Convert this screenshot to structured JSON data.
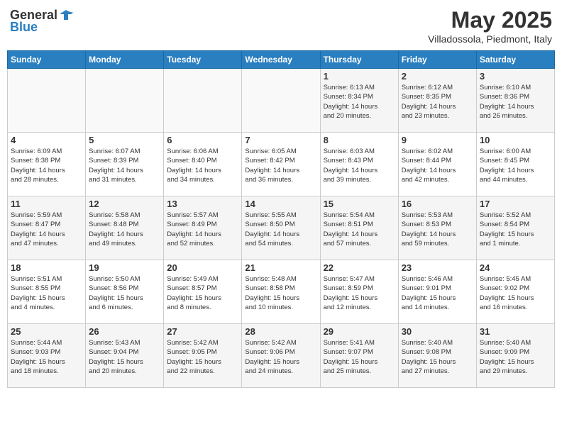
{
  "header": {
    "logo_general": "General",
    "logo_blue": "Blue",
    "month": "May 2025",
    "subtitle": "Villadossola, Piedmont, Italy"
  },
  "days_of_week": [
    "Sunday",
    "Monday",
    "Tuesday",
    "Wednesday",
    "Thursday",
    "Friday",
    "Saturday"
  ],
  "weeks": [
    [
      {
        "day": "",
        "info": ""
      },
      {
        "day": "",
        "info": ""
      },
      {
        "day": "",
        "info": ""
      },
      {
        "day": "",
        "info": ""
      },
      {
        "day": "1",
        "info": "Sunrise: 6:13 AM\nSunset: 8:34 PM\nDaylight: 14 hours\nand 20 minutes."
      },
      {
        "day": "2",
        "info": "Sunrise: 6:12 AM\nSunset: 8:35 PM\nDaylight: 14 hours\nand 23 minutes."
      },
      {
        "day": "3",
        "info": "Sunrise: 6:10 AM\nSunset: 8:36 PM\nDaylight: 14 hours\nand 26 minutes."
      }
    ],
    [
      {
        "day": "4",
        "info": "Sunrise: 6:09 AM\nSunset: 8:38 PM\nDaylight: 14 hours\nand 28 minutes."
      },
      {
        "day": "5",
        "info": "Sunrise: 6:07 AM\nSunset: 8:39 PM\nDaylight: 14 hours\nand 31 minutes."
      },
      {
        "day": "6",
        "info": "Sunrise: 6:06 AM\nSunset: 8:40 PM\nDaylight: 14 hours\nand 34 minutes."
      },
      {
        "day": "7",
        "info": "Sunrise: 6:05 AM\nSunset: 8:42 PM\nDaylight: 14 hours\nand 36 minutes."
      },
      {
        "day": "8",
        "info": "Sunrise: 6:03 AM\nSunset: 8:43 PM\nDaylight: 14 hours\nand 39 minutes."
      },
      {
        "day": "9",
        "info": "Sunrise: 6:02 AM\nSunset: 8:44 PM\nDaylight: 14 hours\nand 42 minutes."
      },
      {
        "day": "10",
        "info": "Sunrise: 6:00 AM\nSunset: 8:45 PM\nDaylight: 14 hours\nand 44 minutes."
      }
    ],
    [
      {
        "day": "11",
        "info": "Sunrise: 5:59 AM\nSunset: 8:47 PM\nDaylight: 14 hours\nand 47 minutes."
      },
      {
        "day": "12",
        "info": "Sunrise: 5:58 AM\nSunset: 8:48 PM\nDaylight: 14 hours\nand 49 minutes."
      },
      {
        "day": "13",
        "info": "Sunrise: 5:57 AM\nSunset: 8:49 PM\nDaylight: 14 hours\nand 52 minutes."
      },
      {
        "day": "14",
        "info": "Sunrise: 5:55 AM\nSunset: 8:50 PM\nDaylight: 14 hours\nand 54 minutes."
      },
      {
        "day": "15",
        "info": "Sunrise: 5:54 AM\nSunset: 8:51 PM\nDaylight: 14 hours\nand 57 minutes."
      },
      {
        "day": "16",
        "info": "Sunrise: 5:53 AM\nSunset: 8:53 PM\nDaylight: 14 hours\nand 59 minutes."
      },
      {
        "day": "17",
        "info": "Sunrise: 5:52 AM\nSunset: 8:54 PM\nDaylight: 15 hours\nand 1 minute."
      }
    ],
    [
      {
        "day": "18",
        "info": "Sunrise: 5:51 AM\nSunset: 8:55 PM\nDaylight: 15 hours\nand 4 minutes."
      },
      {
        "day": "19",
        "info": "Sunrise: 5:50 AM\nSunset: 8:56 PM\nDaylight: 15 hours\nand 6 minutes."
      },
      {
        "day": "20",
        "info": "Sunrise: 5:49 AM\nSunset: 8:57 PM\nDaylight: 15 hours\nand 8 minutes."
      },
      {
        "day": "21",
        "info": "Sunrise: 5:48 AM\nSunset: 8:58 PM\nDaylight: 15 hours\nand 10 minutes."
      },
      {
        "day": "22",
        "info": "Sunrise: 5:47 AM\nSunset: 8:59 PM\nDaylight: 15 hours\nand 12 minutes."
      },
      {
        "day": "23",
        "info": "Sunrise: 5:46 AM\nSunset: 9:01 PM\nDaylight: 15 hours\nand 14 minutes."
      },
      {
        "day": "24",
        "info": "Sunrise: 5:45 AM\nSunset: 9:02 PM\nDaylight: 15 hours\nand 16 minutes."
      }
    ],
    [
      {
        "day": "25",
        "info": "Sunrise: 5:44 AM\nSunset: 9:03 PM\nDaylight: 15 hours\nand 18 minutes."
      },
      {
        "day": "26",
        "info": "Sunrise: 5:43 AM\nSunset: 9:04 PM\nDaylight: 15 hours\nand 20 minutes."
      },
      {
        "day": "27",
        "info": "Sunrise: 5:42 AM\nSunset: 9:05 PM\nDaylight: 15 hours\nand 22 minutes."
      },
      {
        "day": "28",
        "info": "Sunrise: 5:42 AM\nSunset: 9:06 PM\nDaylight: 15 hours\nand 24 minutes."
      },
      {
        "day": "29",
        "info": "Sunrise: 5:41 AM\nSunset: 9:07 PM\nDaylight: 15 hours\nand 25 minutes."
      },
      {
        "day": "30",
        "info": "Sunrise: 5:40 AM\nSunset: 9:08 PM\nDaylight: 15 hours\nand 27 minutes."
      },
      {
        "day": "31",
        "info": "Sunrise: 5:40 AM\nSunset: 9:09 PM\nDaylight: 15 hours\nand 29 minutes."
      }
    ]
  ]
}
